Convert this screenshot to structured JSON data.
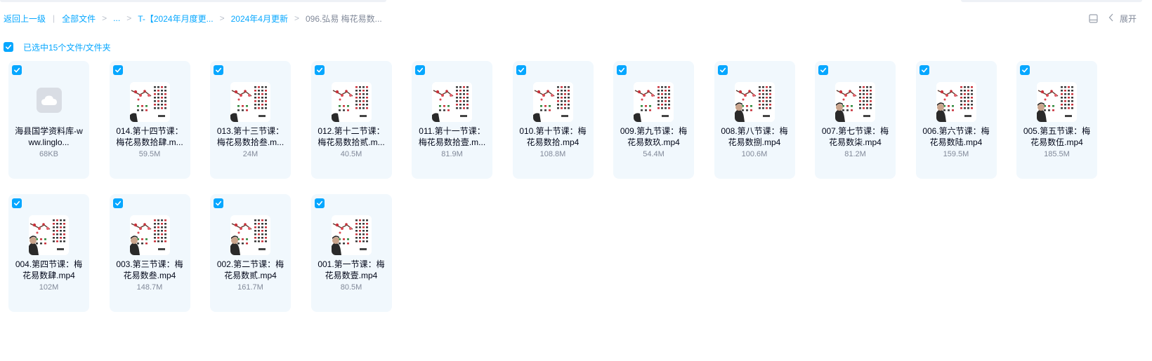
{
  "breadcrumb": {
    "back_label": "返回上一级",
    "all_files_label": "全部文件",
    "ellipsis_label": "...",
    "folder1_label": "T-【2024年月度更...",
    "folder2_label": "2024年4月更新",
    "current_label": "096.弘易 梅花易数...",
    "separator": ">",
    "divider": "|"
  },
  "toolbar": {
    "expand_label": "展开",
    "layout_icon": "sidebar-layout-icon",
    "collapse_icon": "chevron-left-icon"
  },
  "selection": {
    "text": "已选中15个文件/文件夹",
    "checked": true
  },
  "files": [
    {
      "name": "海县国学资料库-www.linglo...",
      "size": "68KB",
      "type": "doc",
      "checked": true
    },
    {
      "name": "014.第十四节课：梅花易数拾肆.m...",
      "size": "59.5M",
      "type": "video",
      "checked": true
    },
    {
      "name": "013.第十三节课：梅花易数拾叁.m...",
      "size": "24M",
      "type": "video",
      "checked": true
    },
    {
      "name": "012.第十二节课：梅花易数拾贰.m...",
      "size": "40.5M",
      "type": "video",
      "checked": true
    },
    {
      "name": "011.第十一节课：梅花易数拾壹.m...",
      "size": "81.9M",
      "type": "video",
      "checked": true
    },
    {
      "name": "010.第十节课：梅花易数拾.mp4",
      "size": "108.8M",
      "type": "video",
      "checked": true
    },
    {
      "name": "009.第九节课：梅花易数玖.mp4",
      "size": "54.4M",
      "type": "video",
      "checked": true
    },
    {
      "name": "008.第八节课：梅花易数捌.mp4",
      "size": "100.6M",
      "type": "video",
      "checked": true
    },
    {
      "name": "007.第七节课：梅花易数柒.mp4",
      "size": "81.2M",
      "type": "video",
      "checked": true
    },
    {
      "name": "006.第六节课：梅花易数陆.mp4",
      "size": "159.5M",
      "type": "video",
      "checked": true
    },
    {
      "name": "005.第五节课：梅花易数伍.mp4",
      "size": "185.5M",
      "type": "video",
      "checked": true
    },
    {
      "name": "004.第四节课：梅花易数肆.mp4",
      "size": "102M",
      "type": "video",
      "checked": true
    },
    {
      "name": "003.第三节课：梅花易数叁.mp4",
      "size": "148.7M",
      "type": "video",
      "checked": true
    },
    {
      "name": "002.第二节课：梅花易数贰.mp4",
      "size": "161.7M",
      "type": "video",
      "checked": true
    },
    {
      "name": "001.第一节课：梅花易数壹.mp4",
      "size": "80.5M",
      "type": "video",
      "checked": true
    }
  ],
  "colors": {
    "accent": "#06a7ff",
    "card_bg": "#f1f8fd",
    "text_primary": "#03081a",
    "text_secondary": "#818999"
  }
}
